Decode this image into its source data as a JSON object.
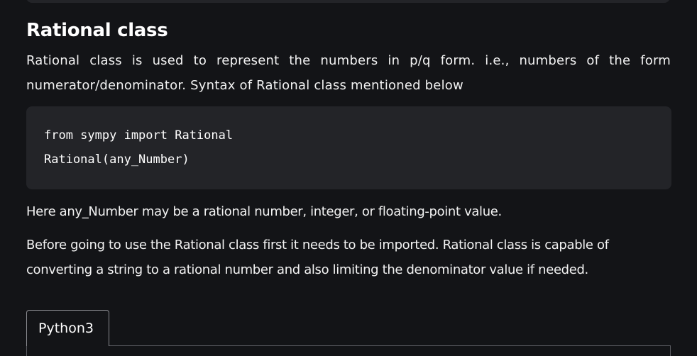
{
  "article": {
    "title": "Rational class",
    "intro": "Rational class is used to represent the numbers in p/q form. i.e., numbers of the form numerator/denominator. Syntax of Rational class mentioned below",
    "code_lines": [
      "from sympy import Rational",
      "Rational(any_Number)"
    ],
    "note": "Here any_Number may be a rational number, integer, or floating-point value.",
    "description": "Before going to use the Rational class first it needs to be imported. Rational class is capable of converting a string to a rational number and also limiting the denominator value if needed."
  },
  "code_tabs": {
    "active_tab": "Python3"
  }
}
